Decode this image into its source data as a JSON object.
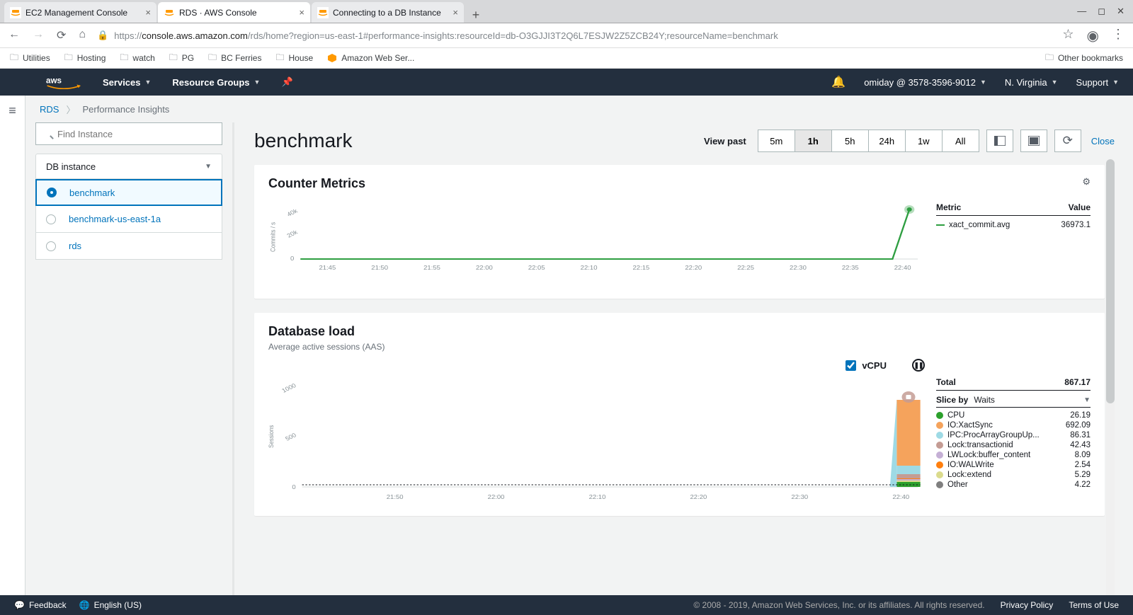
{
  "browser": {
    "tabs": [
      {
        "title": "EC2 Management Console",
        "fav": "aws"
      },
      {
        "title": "RDS · AWS Console",
        "fav": "aws",
        "active": true
      },
      {
        "title": "Connecting to a DB Instance",
        "fav": "aws"
      }
    ],
    "url_proto": "https://",
    "url_host": "console.aws.amazon.com",
    "url_path": "/rds/home?region=us-east-1#performance-insights:resourceId=db-O3GJJI3T2Q6L7ESJW2Z5ZCB24Y;resourceName=benchmark",
    "bookmarks_left": [
      "Utilities",
      "Hosting",
      "watch",
      "PG",
      "BC Ferries",
      "House"
    ],
    "bookmark_aws": "Amazon Web Ser...",
    "bookmarks_right": "Other bookmarks"
  },
  "aws_nav": {
    "menu": [
      "Services",
      "Resource Groups"
    ],
    "account": "omiday @ 3578-3596-9012",
    "region": "N. Virginia",
    "support": "Support"
  },
  "crumb": {
    "root": "RDS",
    "current": "Performance Insights"
  },
  "sidebar": {
    "search_placeholder": "Find Instance",
    "header": "DB instance",
    "instances": [
      {
        "name": "benchmark",
        "selected": true
      },
      {
        "name": "benchmark-us-east-1a"
      },
      {
        "name": "rds"
      }
    ]
  },
  "page": {
    "title": "benchmark",
    "viewpast": "View past",
    "ranges": [
      "5m",
      "1h",
      "5h",
      "24h",
      "1w",
      "All"
    ],
    "range_active": "1h",
    "close": "Close"
  },
  "panel_counter": {
    "title": "Counter Metrics",
    "legend_header_metric": "Metric",
    "legend_header_value": "Value",
    "metric_name": "xact_commit.avg",
    "metric_value": "36973.1",
    "y_label": "Commits / s"
  },
  "panel_load": {
    "title": "Database load",
    "subtitle": "Average active sessions (AAS)",
    "vcpu_label": "vCPU",
    "total_label": "Total",
    "total_value": "867.17",
    "slice_label": "Slice by",
    "slice_value": "Waits",
    "y_label": "Sessions",
    "waits": [
      {
        "name": "CPU",
        "value": "26.19",
        "color": "#2ca02c"
      },
      {
        "name": "IO:XactSync",
        "value": "692.09",
        "color": "#f5a35c"
      },
      {
        "name": "IPC:ProcArrayGroupUp...",
        "value": "86.31",
        "color": "#9edae5"
      },
      {
        "name": "Lock:transactionid",
        "value": "42.43",
        "color": "#c49c94"
      },
      {
        "name": "LWLock:buffer_content",
        "value": "8.09",
        "color": "#c5b0d5"
      },
      {
        "name": "IO:WALWrite",
        "value": "2.54",
        "color": "#ff7f0e"
      },
      {
        "name": "Lock:extend",
        "value": "5.29",
        "color": "#dbdb8d"
      },
      {
        "name": "Other",
        "value": "4.22",
        "color": "#7f7f7f"
      }
    ]
  },
  "chart_data": [
    {
      "type": "line",
      "title": "Counter Metrics",
      "ylabel": "Commits / s",
      "ylim": [
        0,
        40000
      ],
      "yticks": [
        0,
        20000,
        40000
      ],
      "ytick_labels": [
        "0",
        "20k",
        "40k"
      ],
      "x_ticks": [
        "21:45",
        "21:50",
        "21:55",
        "22:00",
        "22:05",
        "22:10",
        "22:15",
        "22:20",
        "22:25",
        "22:30",
        "22:35",
        "22:40"
      ],
      "series": [
        {
          "name": "xact_commit.avg",
          "color": "#2e9e41",
          "values": [
            0,
            0,
            0,
            0,
            0,
            0,
            0,
            0,
            0,
            0,
            0,
            36973
          ]
        }
      ]
    },
    {
      "type": "area",
      "title": "Database load",
      "ylabel": "Sessions",
      "ylim": [
        0,
        1000
      ],
      "yticks": [
        0,
        500,
        1000
      ],
      "x_ticks": [
        "21:50",
        "22:00",
        "22:10",
        "22:20",
        "22:30",
        "22:40"
      ],
      "stack_order": [
        "CPU",
        "Lock:extend",
        "LWLock:buffer_content",
        "IO:WALWrite",
        "Lock:transactionid",
        "IPC:ProcArrayGroupUp...",
        "IO:XactSync"
      ],
      "series": [
        {
          "name": "CPU",
          "color": "#2ca02c",
          "values": [
            0,
            0,
            0,
            0,
            0,
            26.19
          ]
        },
        {
          "name": "IO:XactSync",
          "color": "#f5a35c",
          "values": [
            0,
            0,
            0,
            0,
            0,
            692.09
          ]
        },
        {
          "name": "IPC:ProcArrayGroupUp...",
          "color": "#9edae5",
          "values": [
            0,
            0,
            0,
            0,
            0,
            86.31
          ]
        },
        {
          "name": "Lock:transactionid",
          "color": "#c49c94",
          "values": [
            0,
            0,
            0,
            0,
            0,
            42.43
          ]
        },
        {
          "name": "LWLock:buffer_content",
          "color": "#c5b0d5",
          "values": [
            0,
            0,
            0,
            0,
            0,
            8.09
          ]
        },
        {
          "name": "IO:WALWrite",
          "color": "#ff7f0e",
          "values": [
            0,
            0,
            0,
            0,
            0,
            2.54
          ]
        },
        {
          "name": "Lock:extend",
          "color": "#dbdb8d",
          "values": [
            0,
            0,
            0,
            0,
            0,
            5.29
          ]
        },
        {
          "name": "Other",
          "color": "#7f7f7f",
          "values": [
            0,
            0,
            0,
            0,
            0,
            4.22
          ]
        }
      ],
      "reference_line": {
        "label": "vCPU",
        "value": 16
      }
    }
  ],
  "footer": {
    "feedback": "Feedback",
    "lang": "English (US)",
    "copy": "© 2008 - 2019, Amazon Web Services, Inc. or its affiliates. All rights reserved.",
    "privacy": "Privacy Policy",
    "terms": "Terms of Use"
  }
}
